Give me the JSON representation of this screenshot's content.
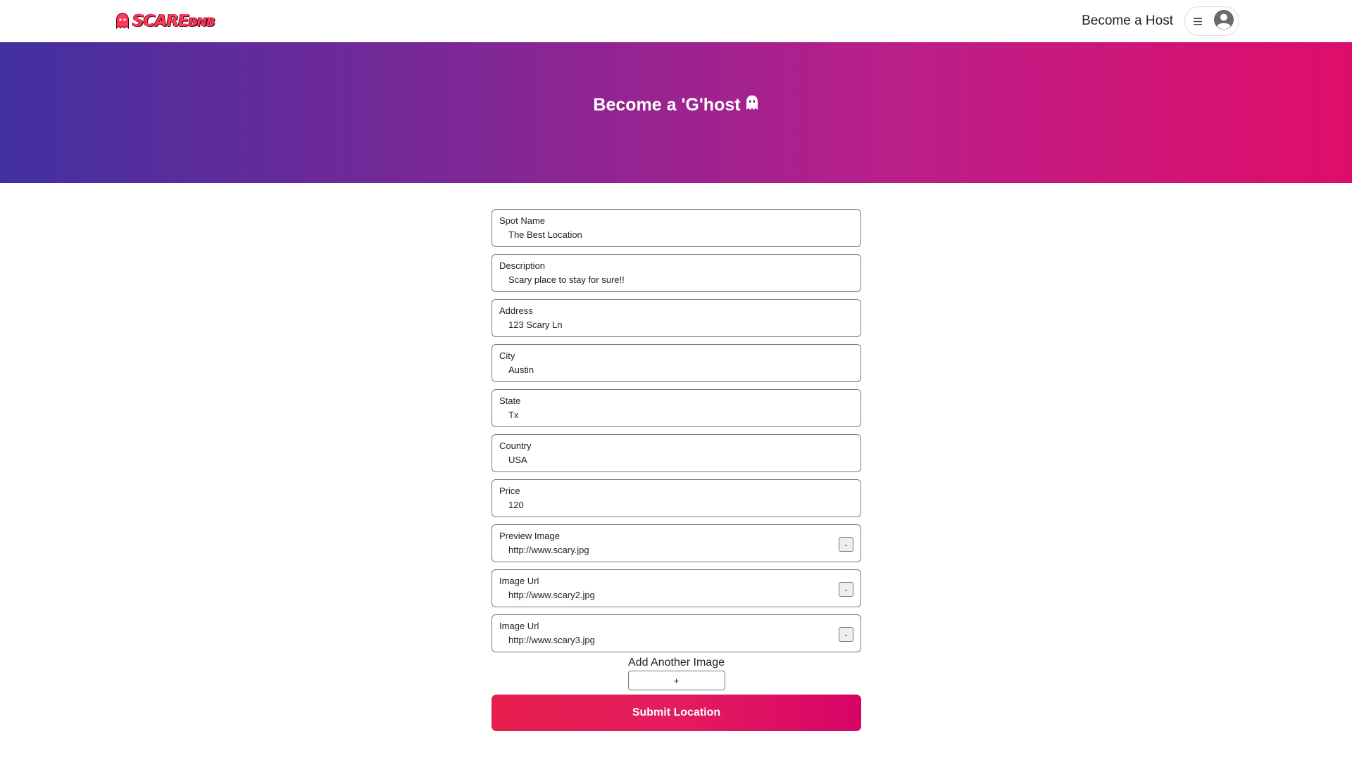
{
  "brand": {
    "logo_text_main": "SCARE",
    "logo_text_suffix": "BNB",
    "icon": "ghost-icon",
    "accent_color": "#ff385c"
  },
  "nav": {
    "become_host_label": "Become a Host",
    "menu_icon": "hamburger-icon",
    "avatar_icon": "user-avatar-icon"
  },
  "hero": {
    "title": "Become a 'G'host",
    "icon": "ghost-icon",
    "gradient": [
      "#4230a0",
      "#7e2796",
      "#b81f8a",
      "#df0d6a"
    ]
  },
  "form": {
    "fields": [
      {
        "label": "Spot Name",
        "value": "The Best Location"
      },
      {
        "label": "Description",
        "value": "Scary place to stay for sure!!"
      },
      {
        "label": "Address",
        "value": "123 Scary Ln"
      },
      {
        "label": "City",
        "value": "Austin"
      },
      {
        "label": "State",
        "value": "Tx"
      },
      {
        "label": "Country",
        "value": "USA"
      },
      {
        "label": "Price",
        "value": "120"
      },
      {
        "label": "Preview Image",
        "value": "http://www.scary.jpg",
        "remove_label": "-"
      },
      {
        "label": "Image Url",
        "value": "http://www.scary2.jpg",
        "remove_label": "-"
      },
      {
        "label": "Image Url",
        "value": "http://www.scary3.jpg",
        "remove_label": "-"
      }
    ],
    "add_image_label": "Add Another Image",
    "add_image_button": "+",
    "submit_label": "Submit Location",
    "submit_color": "#e61e4d"
  }
}
